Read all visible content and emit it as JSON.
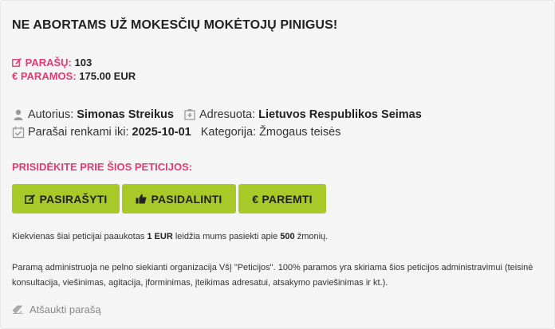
{
  "petition": {
    "title": "NE ABORTAMS UŽ MOKESČIŲ MOKĖTOJŲ PINIGUS!",
    "signatures_label": "PARAŠŲ:",
    "signatures_value": "103",
    "funding_label": "€ PARAMOS:",
    "funding_value": "175.00 EUR",
    "author_label": "Autorius:",
    "author_value": "Simonas Streikus",
    "addressed_label": "Adresuota:",
    "addressed_value": "Lietuvos Respublikos Seimas",
    "deadline_label": "Parašai renkami iki:",
    "deadline_value": "2025-10-01",
    "category_label": "Kategorija:",
    "category_value": "Žmogaus teisės",
    "join_heading": "PRISIDĖKITE PRIE ŠIOS PETICIJOS:"
  },
  "actions": {
    "sign_label": "PASIRAŠYTI",
    "share_label": "PASIDALINTI",
    "support_label": "€ PAREMTI"
  },
  "note": {
    "part1": "Kiekvienas šiai peticijai paaukotas ",
    "amount": "1 EUR",
    "part2": " leidžia mums pasiekti apie ",
    "people": "500",
    "part3": " žmonių."
  },
  "info_text": "Paramą administruoja ne pelno siekianti organizacija VšĮ \"Peticijos\". 100% paramos yra skiriama šios peticijos administravimui (teisinė konsultacija, viešinimas, agitacija, įforminimas, įteikimas adresatui, atsakymo paviešinimas ir kt.).",
  "cancel_label": "Atšaukti parašą",
  "colors": {
    "accent": "#e23a76",
    "button": "#a9c928",
    "background": "#f5f5f5"
  },
  "icons": [
    "edit-icon",
    "user-icon",
    "hospital-icon",
    "calendar-check-icon",
    "thumbs-up-icon",
    "eraser-icon"
  ]
}
